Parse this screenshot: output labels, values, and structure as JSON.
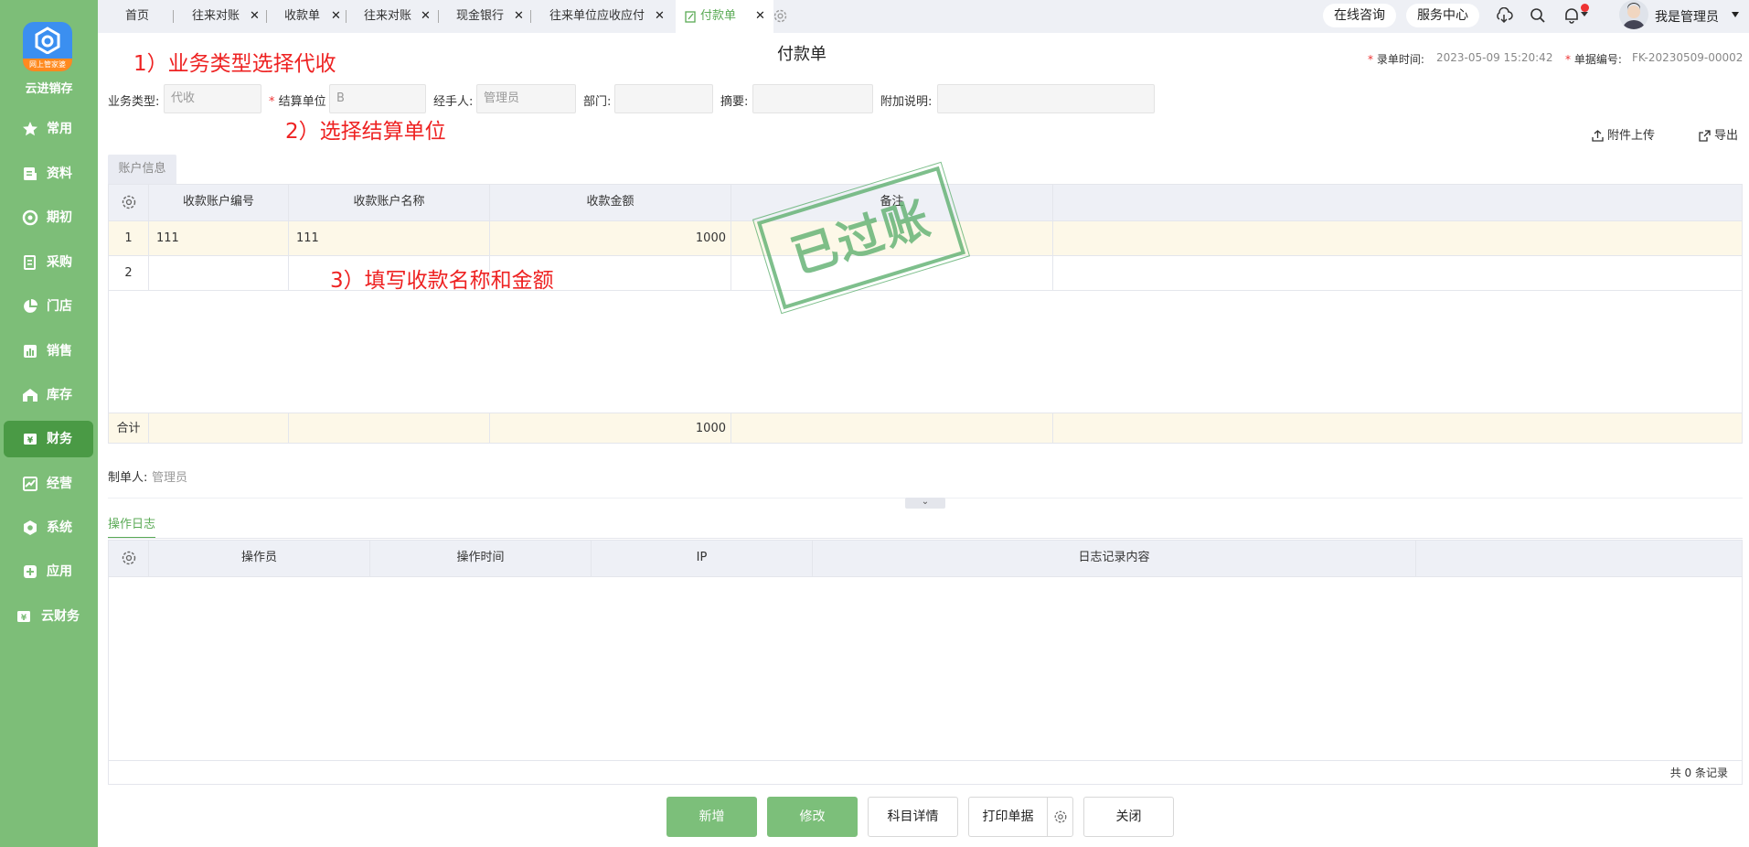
{
  "sidebar": {
    "logo_tag": "网上管家婆",
    "brand": "云进销存",
    "items": [
      {
        "label": "常用",
        "icon": "star-icon"
      },
      {
        "label": "资料",
        "icon": "document-icon"
      },
      {
        "label": "期初",
        "icon": "target-icon"
      },
      {
        "label": "采购",
        "icon": "purchase-icon"
      },
      {
        "label": "门店",
        "icon": "pie-chart-icon"
      },
      {
        "label": "销售",
        "icon": "sales-chart-icon"
      },
      {
        "label": "库存",
        "icon": "warehouse-icon"
      },
      {
        "label": "财务",
        "icon": "finance-icon"
      },
      {
        "label": "经营",
        "icon": "trend-icon"
      },
      {
        "label": "系统",
        "icon": "hexagon-gear-icon"
      },
      {
        "label": "应用",
        "icon": "plus-square-icon"
      },
      {
        "label": "云财务",
        "icon": "cloud-finance-icon"
      }
    ],
    "active": "财务"
  },
  "tabs": [
    {
      "label": "首页"
    },
    {
      "label": "往来对账"
    },
    {
      "label": "收款单"
    },
    {
      "label": "往来对账"
    },
    {
      "label": "现金银行"
    },
    {
      "label": "往来单位应收应付"
    },
    {
      "label": "付款单"
    }
  ],
  "topbar": {
    "consult": "在线咨询",
    "service": "服务中心",
    "user_name": "我是管理员"
  },
  "annotations": {
    "step1": "1）业务类型选择代收",
    "step2": "2）选择结算单位",
    "step3": "3）填写收款名称和金额"
  },
  "doc": {
    "title": "付款单",
    "entry_time_label": "录单时间:",
    "entry_time": "2023-05-09 15:20:42",
    "doc_no_label": "单据编号:",
    "doc_no": "FK-20230509-00002"
  },
  "form": {
    "biz_type_label": "业务类型:",
    "biz_type": "代收",
    "settle_unit_label": "结算单位",
    "settle_unit": "B",
    "handler_label": "经手人:",
    "handler": "管理员",
    "dept_label": "部门:",
    "dept": "",
    "summary_label": "摘要:",
    "summary": "",
    "extra_label": "附加说明:",
    "extra": ""
  },
  "actions": {
    "upload": "附件上传",
    "export": "导出"
  },
  "account_tab": "账户信息",
  "account_table": {
    "headers": [
      "收款账户编号",
      "收款账户名称",
      "收款金额",
      "备注"
    ],
    "rows": [
      {
        "no": "1",
        "code": "111",
        "name": "111",
        "amount": "1000",
        "remark": ""
      },
      {
        "no": "2",
        "code": "",
        "name": "",
        "amount": "",
        "remark": ""
      }
    ],
    "total_label": "合计",
    "total_amount": "1000"
  },
  "stamp": "已过账",
  "maker": {
    "label": "制单人:",
    "value": "管理员"
  },
  "log": {
    "tab": "操作日志",
    "headers": [
      "操作员",
      "操作时间",
      "IP",
      "日志记录内容"
    ],
    "count": "共 0 条记录"
  },
  "buttons": {
    "add": "新增",
    "edit": "修改",
    "subject": "科目详情",
    "print": "打印单据",
    "close": "关闭"
  },
  "colors": {
    "sidebar": "#7dbe78",
    "active": "#4a9a45",
    "accent": "#5aaa55",
    "annotation": "#ee2222"
  }
}
